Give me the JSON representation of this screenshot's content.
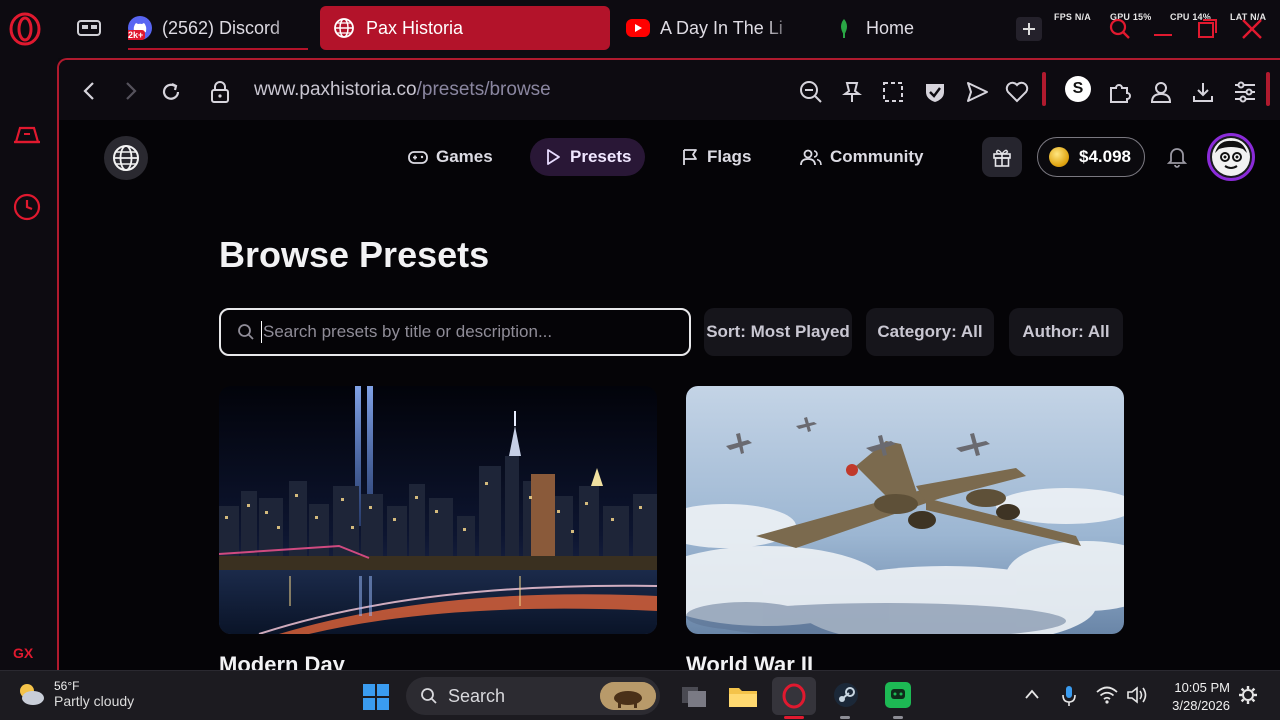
{
  "browser": {
    "tabs": [
      {
        "label": "(2562) Discord",
        "badge": "2k+"
      },
      {
        "label": "Pax Historia",
        "active": true
      },
      {
        "label": "A Day In The Li"
      },
      {
        "label": "Home"
      }
    ],
    "stats": {
      "fps_label": "FPS",
      "fps": "N/A",
      "gpu_label": "GPU",
      "gpu": "15%",
      "cpu_label": "CPU",
      "cpu": "14%",
      "lat_label": "LAT",
      "lat": "N/A"
    },
    "url_host": "www.paxhistoria.co",
    "url_path": "/presets/browse",
    "sidebar_gx": "GX",
    "sidebar_more": "•••",
    "extension_badge": "S",
    "accent": "#b3132a"
  },
  "site": {
    "nav": [
      {
        "label": "Games",
        "icon": "gamepad-icon"
      },
      {
        "label": "Presets",
        "icon": "play-icon",
        "active": true
      },
      {
        "label": "Flags",
        "icon": "flag-icon"
      },
      {
        "label": "Community",
        "icon": "users-icon"
      }
    ],
    "balance": "$4.098",
    "page_title": "Browse Presets",
    "search_placeholder": "Search presets by title or description...",
    "filters": {
      "sort": "Sort: Most Played",
      "category": "Category: All",
      "author": "Author: All"
    },
    "presets": [
      {
        "title": "Modern Day"
      },
      {
        "title": "World War II"
      }
    ],
    "brand_purple": "#8b2bd9"
  },
  "taskbar": {
    "temp": "56°F",
    "condition": "Partly cloudy",
    "search": "Search",
    "time": "10:05 PM",
    "date": "3/28/2026"
  }
}
